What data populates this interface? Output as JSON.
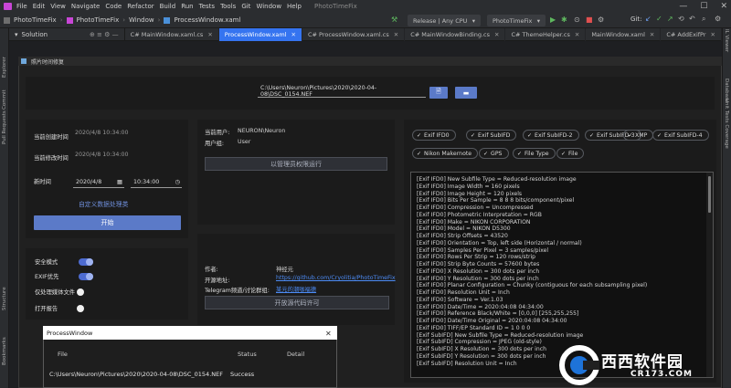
{
  "ide": {
    "menu": [
      "File",
      "Edit",
      "View",
      "Navigate",
      "Code",
      "Refactor",
      "Build",
      "Run",
      "Tests",
      "Tools",
      "Git",
      "Window",
      "Help"
    ],
    "window_title": "PhotoTimeFix",
    "breadcrumb": [
      "PhotoTimeFix",
      "PhotoTimeFix",
      "Window",
      "ProcessWindow.xaml"
    ],
    "run_config": "Release | Any CPU",
    "project_config": "PhotoTimeFix",
    "git_label": "Git:",
    "solution_label": "Solution",
    "tabs": [
      {
        "label": "C# MainWindow.xaml.cs",
        "active": false
      },
      {
        "label": "ProcessWindow.xaml",
        "active": true
      },
      {
        "label": "C# ProcessWindow.xaml.cs",
        "active": false
      },
      {
        "label": "C# MainWindowBinding.cs",
        "active": false
      },
      {
        "label": "C# ThemeHelper.cs",
        "active": false
      },
      {
        "label": "MainWindow.xaml",
        "active": false
      },
      {
        "label": "C# AddExifPr",
        "active": false
      }
    ],
    "left_strip": [
      "Explorer",
      "Commit",
      "Pull Requests",
      "Structure",
      "Bookmarks"
    ],
    "right_strip": [
      "IL Viewer",
      "Database",
      "Unit Tests Coverage"
    ]
  },
  "app": {
    "title": "照片时间修复",
    "path": "C:\\Users\\Neuron\\Pictures\\2020\\2020-04-08\\DSC_0154.NEF",
    "created_label": "当前创建时间",
    "created_value": "2020/4/8 10:34:00",
    "modified_label": "当前修改时间",
    "modified_value": "2020/4/8 10:34:00",
    "new_time_label": "新时间",
    "new_date": "2020/4/8",
    "new_time": "10:34:00",
    "custom_label": "自定义数据处理类",
    "start_label": "开始",
    "user_label": "当前用户:",
    "user_value": "NEURON\\Neuron",
    "group_label": "用户组:",
    "group_value": "User",
    "admin_label": "以管理员权限运行",
    "toggles": [
      {
        "label": "安全模式",
        "on": true
      },
      {
        "label": "EXIF优先",
        "on": true
      },
      {
        "label": "仅处理媒体文件",
        "on": false
      },
      {
        "label": "打开报告",
        "on": false
      }
    ],
    "author_label": "作者:",
    "author_value": "神经元",
    "repo_label": "开源地址:",
    "repo_value": "https://github.com/Cryolitia/PhotoTimeFix",
    "telegram_label": "Telegram频道/讨论群组:",
    "telegram_value": "某元的潮咖福德",
    "license_label": "开放源代码许可",
    "chips": [
      "Exif IFD0",
      "Exif SubIFD",
      "Exif SubIFD-2",
      "Exif SubIFD-3",
      "XMP",
      "Exif SubIFD-4",
      "Nikon Makernote",
      "GPS",
      "File Type",
      "File"
    ],
    "exif_lines": [
      "[Exif IFD0] New Subfile Type = Reduced-resolution image",
      "[Exif IFD0] Image Width = 160 pixels",
      "[Exif IFD0] Image Height = 120 pixels",
      "[Exif IFD0] Bits Per Sample = 8 8 8 bits/component/pixel",
      "[Exif IFD0] Compression = Uncompressed",
      "[Exif IFD0] Photometric Interpretation = RGB",
      "[Exif IFD0] Make = NIKON CORPORATION",
      "[Exif IFD0] Model = NIKON D5300",
      "[Exif IFD0] Strip Offsets = 43520",
      "[Exif IFD0] Orientation = Top, left side (Horizontal / normal)",
      "[Exif IFD0] Samples Per Pixel = 3 samples/pixel",
      "[Exif IFD0] Rows Per Strip = 120 rows/strip",
      "[Exif IFD0] Strip Byte Counts = 57600 bytes",
      "[Exif IFD0] X Resolution = 300 dots per inch",
      "[Exif IFD0] Y Resolution = 300 dots per inch",
      "[Exif IFD0] Planar Configuration = Chunky (contiguous for each subsampling pixel)",
      "[Exif IFD0] Resolution Unit = Inch",
      "[Exif IFD0] Software = Ver.1.03",
      "[Exif IFD0] Date/Time = 2020:04:08 04:34:00",
      "[Exif IFD0] Reference Black/White = [0,0,0] [255,255,255]",
      "[Exif IFD0] Date/Time Original = 2020:04:08 04:34:00",
      "[Exif IFD0] TIFF/EP Standard ID = 1 0 0 0",
      "[Exif SubIFD] New Subfile Type = Reduced-resolution image",
      "[Exif SubIFD] Compression = JPEG (old-style)",
      "[Exif SubIFD] X Resolution = 300 dots per inch",
      "[Exif SubIFD] Y Resolution = 300 dots per inch",
      "[Exif SubIFD] Resolution Unit = Inch"
    ]
  },
  "process": {
    "title": "ProcessWindow",
    "col_file": "File",
    "col_status": "Status",
    "col_detail": "Detail",
    "row_file": "C:\\Users\\Neuron\\Pictures\\2020\\2020-04-08\\DSC_0154.NEF",
    "row_status": "Success",
    "row_detail": ""
  },
  "watermark": {
    "text1": "西西软件园",
    "text2": "CR173.COM"
  }
}
